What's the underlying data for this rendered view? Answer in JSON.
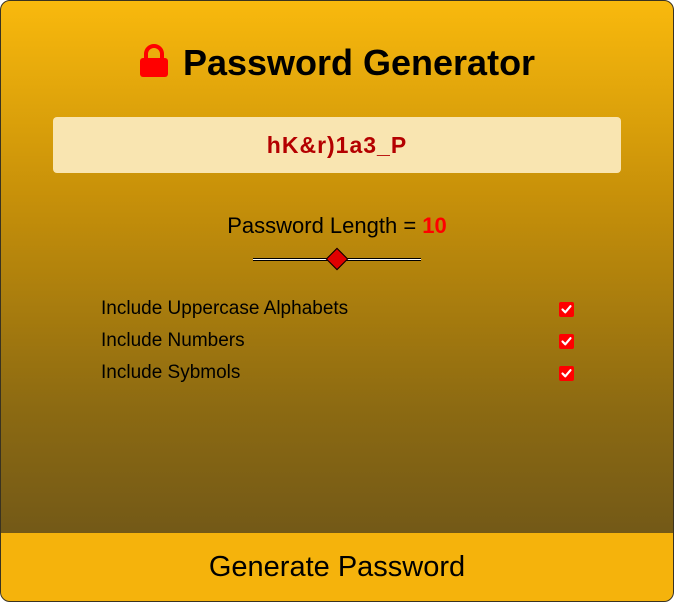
{
  "title": "Password Generator",
  "password": "hK&r)1a3_P",
  "length": {
    "label": "Password Length = ",
    "value": "10",
    "min": 0,
    "max": 20,
    "current": 10
  },
  "options": [
    {
      "label": "Include Uppercase Alphabets",
      "checked": true
    },
    {
      "label": "Include Numbers",
      "checked": true
    },
    {
      "label": "Include Sybmols",
      "checked": true
    }
  ],
  "generate_label": "Generate Password",
  "colors": {
    "accent": "#ff0000",
    "password_text": "#b40000",
    "password_bg": "#f9e5b1",
    "button_bg": "#f5b30c",
    "gradient_top": "#f9b90d",
    "gradient_bottom": "#66501a"
  },
  "icons": {
    "title": "lock-icon",
    "checkbox": "checkmark-icon"
  }
}
